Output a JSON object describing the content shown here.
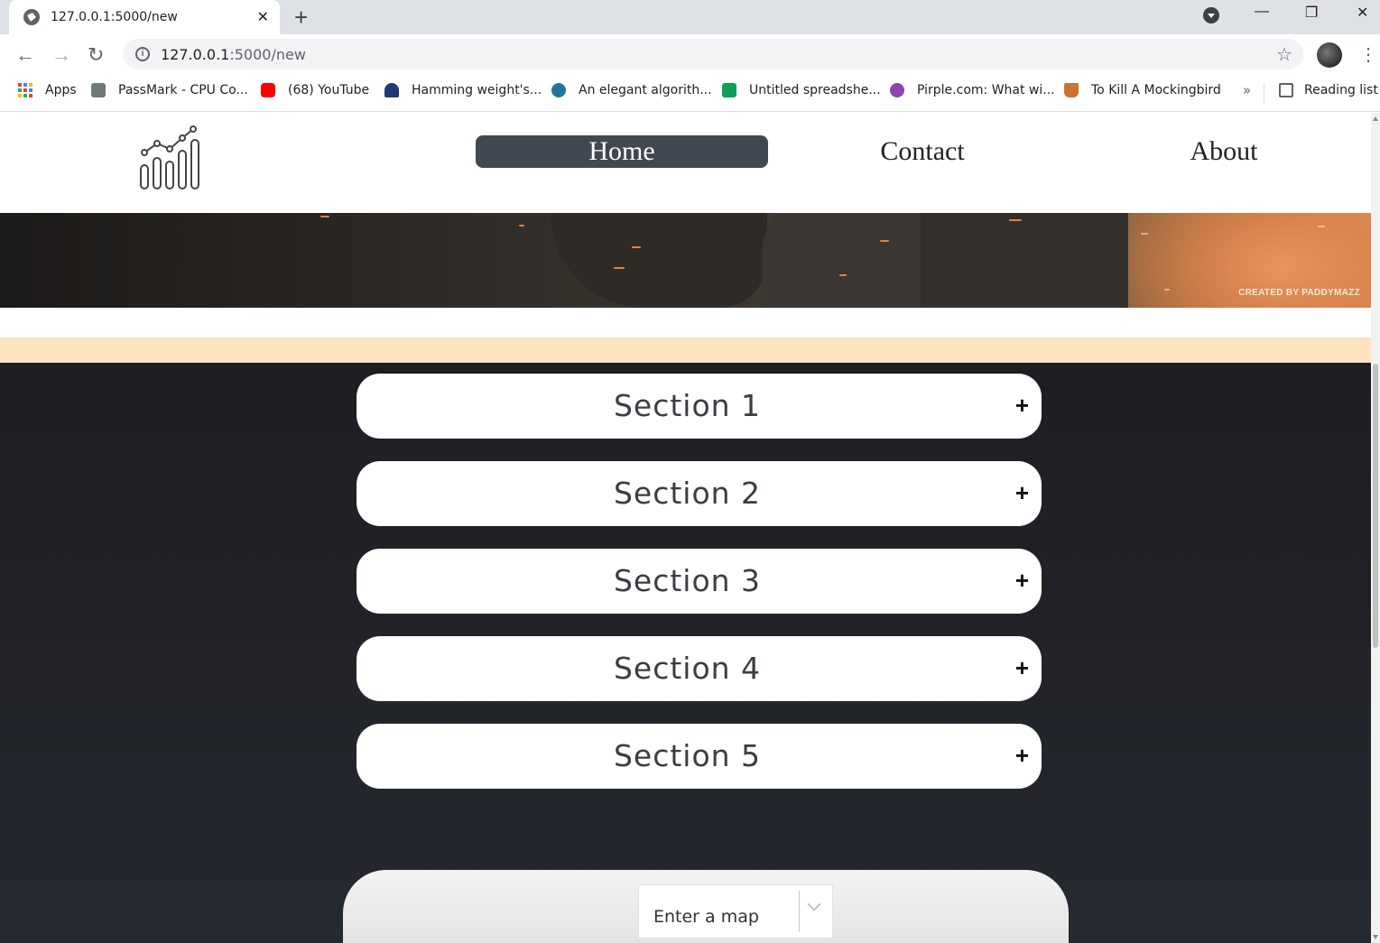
{
  "browser": {
    "tab_title": "127.0.0.1:5000/new",
    "url_host": "127.0.0.1",
    "url_path": ":5000/new",
    "bookmarks": [
      {
        "label": "Apps",
        "icon": "apps-grid-icon"
      },
      {
        "label": "PassMark - CPU Co...",
        "icon": "passmark-icon"
      },
      {
        "label": "(68) YouTube",
        "icon": "youtube-icon"
      },
      {
        "label": "Hamming weight's...",
        "icon": "stackexchange-icon"
      },
      {
        "label": "An elegant algorith...",
        "icon": "wordpress-icon"
      },
      {
        "label": "Untitled spreadshe...",
        "icon": "sheets-icon"
      },
      {
        "label": "Pirple.com: What wi...",
        "icon": "pirple-icon"
      },
      {
        "label": "To Kill A Mockingbird",
        "icon": "mockingbird-icon"
      }
    ],
    "reading_list": "Reading list",
    "more_bookmarks": "»"
  },
  "nav": {
    "links": [
      "Home",
      "Contact",
      "About"
    ],
    "active": "Home"
  },
  "banner": {
    "credit": "CREATED BY PADDYMAZZ"
  },
  "sections": [
    {
      "label": "Section 1",
      "toggle": "+"
    },
    {
      "label": "Section 2",
      "toggle": "+"
    },
    {
      "label": "Section 3",
      "toggle": "+"
    },
    {
      "label": "Section 4",
      "toggle": "+"
    },
    {
      "label": "Section 5",
      "toggle": "+"
    }
  ],
  "map_select": {
    "value": "Enter a map"
  },
  "colors": {
    "nav_active_bg": "#414852",
    "peach_strip": "#fde3c2",
    "dark_bg": "#1e1d22"
  }
}
